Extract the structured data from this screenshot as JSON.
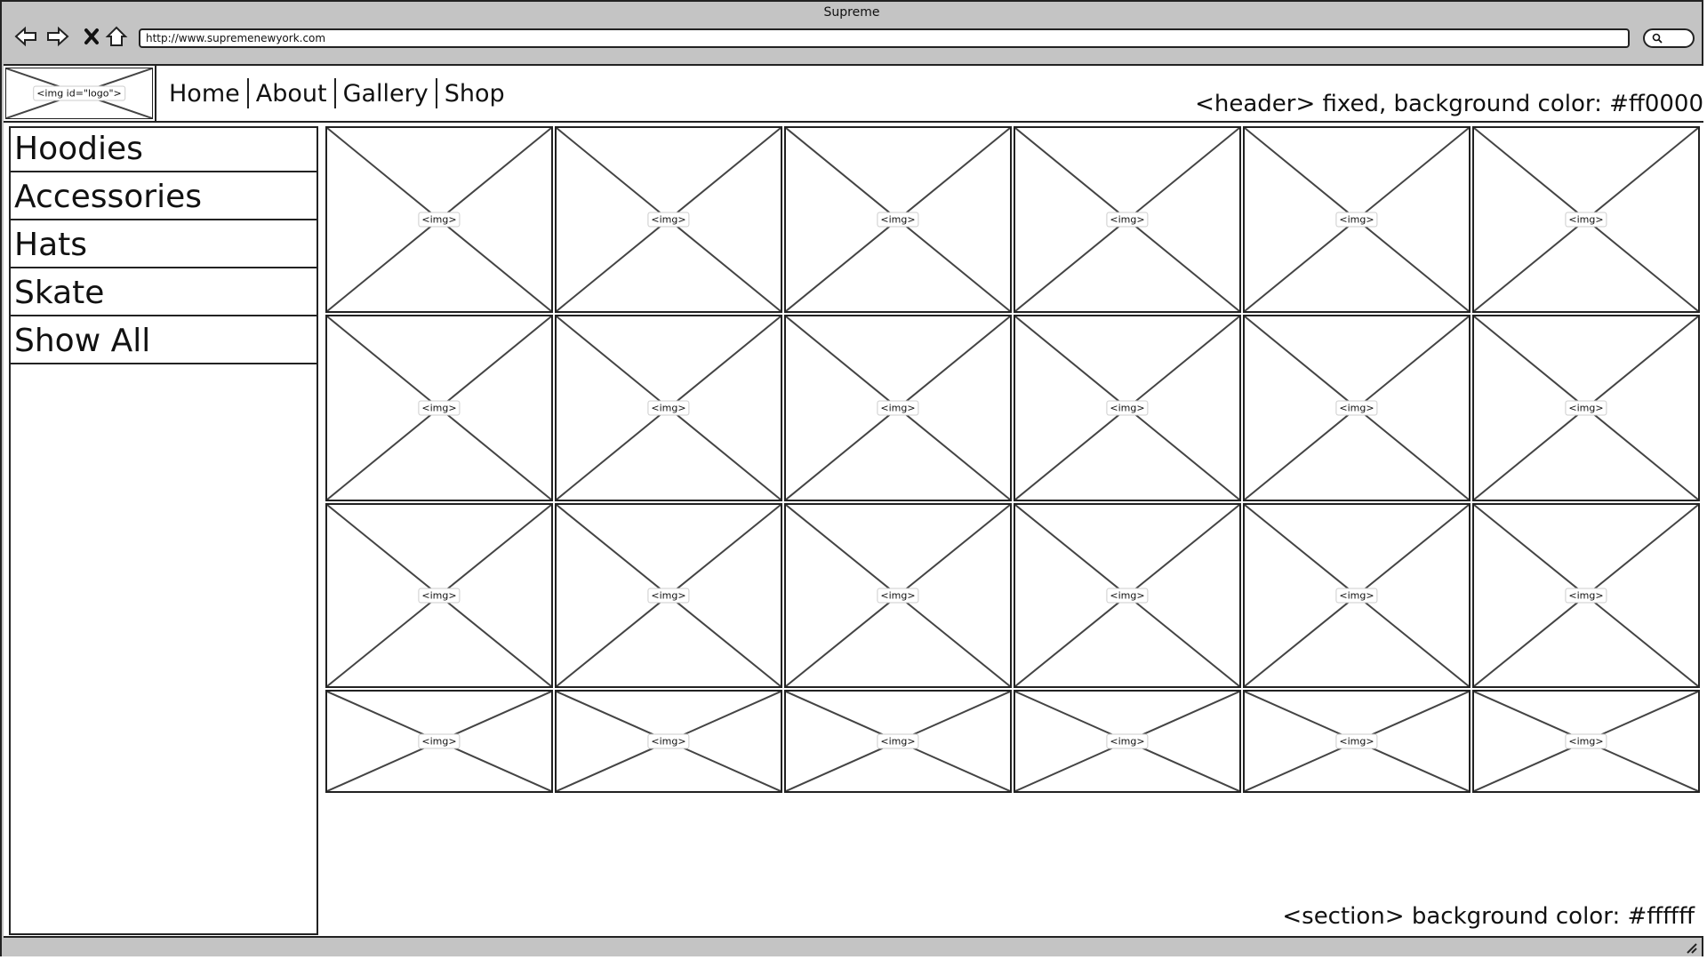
{
  "browser": {
    "title": "Supreme",
    "url": "http://www.supremenewyork.com"
  },
  "header": {
    "logo_label": "<img id=\"logo\">",
    "nav": [
      "Home",
      "About",
      "Gallery",
      "Shop"
    ],
    "note": "<header> fixed, background color: #ff0000"
  },
  "sidebar": {
    "items": [
      "Hoodies",
      "Accessories",
      "Hats",
      "Skate",
      "Show All"
    ]
  },
  "gallery": {
    "rows": 4,
    "columns": 6,
    "image_label": "<img>",
    "note": "<section> background color: #ffffff"
  }
}
